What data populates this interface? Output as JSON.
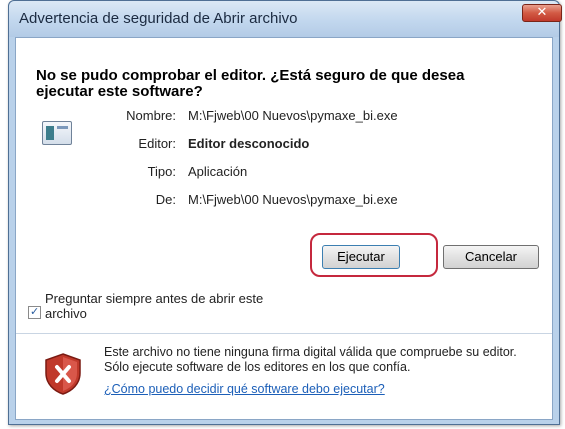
{
  "window": {
    "title": "Advertencia de seguridad de Abrir archivo",
    "close_label": "✕"
  },
  "heading": "No se pudo comprobar el editor. ¿Está seguro de que desea ejecutar este software?",
  "info": [
    {
      "label": "Nombre:",
      "value": "M:\\Fjweb\\00 Nuevos\\pymaxe_bi.exe"
    },
    {
      "label": "Editor:",
      "value": "Editor desconocido"
    },
    {
      "label": "Tipo:",
      "value": "Aplicación"
    },
    {
      "label": "De:",
      "value": "M:\\Fjweb\\00 Nuevos\\pymaxe_bi.exe"
    }
  ],
  "buttons": {
    "run": "Ejecutar",
    "cancel": "Cancelar"
  },
  "checkbox": {
    "label": "Preguntar siempre antes de abrir este archivo",
    "checked": true
  },
  "warning": {
    "text": "Este archivo no tiene ninguna firma digital válida que compruebe su editor. Sólo ejecute software de los editores en los que confía.",
    "link": "¿Cómo puedo decidir qué software debo ejecutar?"
  },
  "colors": {
    "titlebar": "#c2d7ee",
    "highlight": "#c5283d",
    "link": "#1c5fb8",
    "shield": "#c0392b"
  },
  "icons": {
    "file": "file-icon",
    "warning": "shield-x-icon"
  }
}
